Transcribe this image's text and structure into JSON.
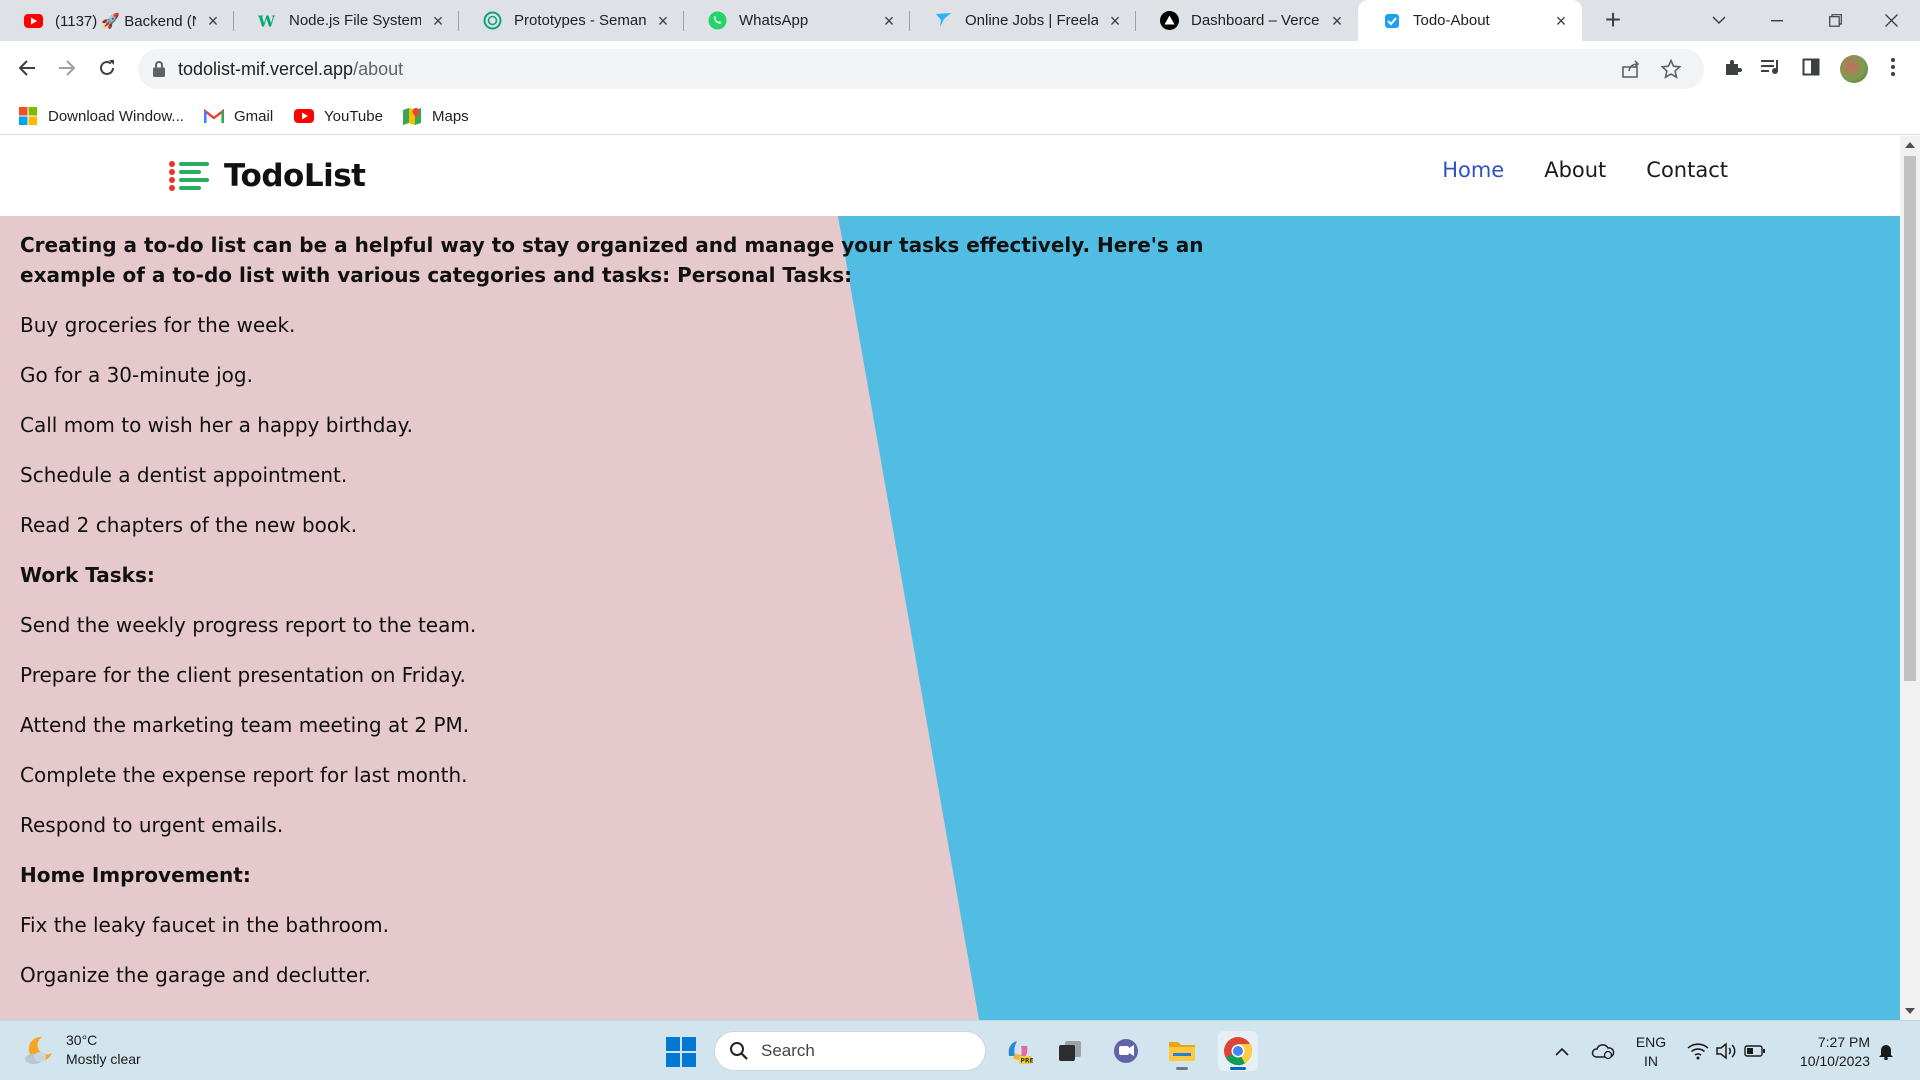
{
  "browser": {
    "tabs": [
      {
        "label": "(1137) 🚀 Backend (N",
        "icon": "youtube-icon",
        "active": false
      },
      {
        "label": "Node.js File System M",
        "icon": "w3schools-icon",
        "active": false
      },
      {
        "label": "Prototypes - Semanti",
        "icon": "openai-icon",
        "active": false
      },
      {
        "label": "WhatsApp",
        "icon": "whatsapp-icon",
        "active": false
      },
      {
        "label": "Online Jobs | Freelan",
        "icon": "freelancer-icon",
        "active": false
      },
      {
        "label": "Dashboard – Vercel",
        "icon": "vercel-icon",
        "active": false
      },
      {
        "label": "Todo-About",
        "icon": "todo-check-icon",
        "active": true
      }
    ],
    "url_host": "todolist-mif.vercel.app",
    "url_path": "/about",
    "bookmarks": [
      {
        "label": "Download Window...",
        "icon": "windows-icon"
      },
      {
        "label": "Gmail",
        "icon": "gmail-icon"
      },
      {
        "label": "YouTube",
        "icon": "youtube-icon"
      },
      {
        "label": "Maps",
        "icon": "maps-icon"
      }
    ]
  },
  "page": {
    "brand": "TodoList",
    "nav": [
      {
        "label": "Home",
        "active": true
      },
      {
        "label": "About",
        "active": false
      },
      {
        "label": "Contact",
        "active": false
      }
    ],
    "intro": "Creating a to-do list can be a helpful way to stay organized and manage your tasks effectively. Here's an example of a to-do list with various categories and tasks: Personal Tasks:",
    "personal_tasks": [
      "Buy groceries for the week.",
      "Go for a 30-minute jog.",
      "Call mom to wish her a happy birthday.",
      "Schedule a dentist appointment.",
      "Read 2 chapters of the new book."
    ],
    "work_heading": "Work Tasks:",
    "work_tasks": [
      "Send the weekly progress report to the team.",
      "Prepare for the client presentation on Friday.",
      "Attend the marketing team meeting at 2 PM.",
      "Complete the expense report for last month.",
      "Respond to urgent emails."
    ],
    "home_heading": "Home Improvement:",
    "home_tasks": [
      "Fix the leaky faucet in the bathroom.",
      "Organize the garage and declutter."
    ],
    "colors": {
      "pink_panel": "#e6c9cc",
      "blue_panel": "#52bde3",
      "nav_active": "#2f52c6"
    }
  },
  "taskbar": {
    "weather_temp": "30°C",
    "weather_desc": "Mostly clear",
    "search_label": "Search",
    "lang_line1": "ENG",
    "lang_line2": "IN",
    "time": "7:27 PM",
    "date": "10/10/2023"
  }
}
